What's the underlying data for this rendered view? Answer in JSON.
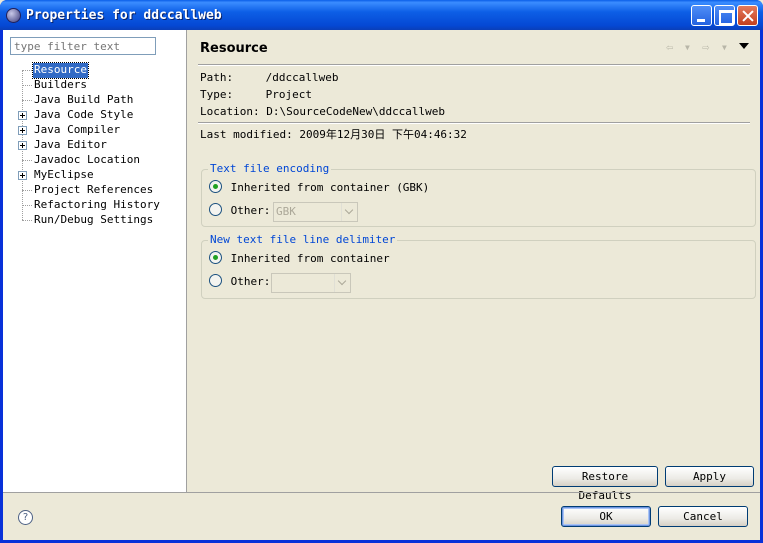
{
  "window": {
    "title": "Properties for ddccallweb"
  },
  "filter": {
    "placeholder": "type filter text"
  },
  "tree": {
    "items": [
      {
        "label": "Resource",
        "selected": true,
        "expandable": false
      },
      {
        "label": "Builders",
        "selected": false,
        "expandable": false
      },
      {
        "label": "Java Build Path",
        "selected": false,
        "expandable": false
      },
      {
        "label": "Java Code Style",
        "selected": false,
        "expandable": true
      },
      {
        "label": "Java Compiler",
        "selected": false,
        "expandable": true
      },
      {
        "label": "Java Editor",
        "selected": false,
        "expandable": true
      },
      {
        "label": "Javadoc Location",
        "selected": false,
        "expandable": false
      },
      {
        "label": "MyEclipse",
        "selected": false,
        "expandable": true
      },
      {
        "label": "Project References",
        "selected": false,
        "expandable": false
      },
      {
        "label": "Refactoring History",
        "selected": false,
        "expandable": false
      },
      {
        "label": "Run/Debug Settings",
        "selected": false,
        "expandable": false
      }
    ]
  },
  "page": {
    "title": "Resource",
    "path_label": "Path:",
    "path_value": "/ddccallweb",
    "type_label": "Type:",
    "type_value": "Project",
    "location_label": "Location:",
    "location_value": "D:\\SourceCodeNew\\ddccallweb",
    "modified_label": "Last modified:",
    "modified_value": "2009年12月30日 下午04:46:32"
  },
  "encoding": {
    "legend": "Text file encoding",
    "inherited_label": "Inherited from container (GBK)",
    "other_label": "Other:",
    "other_value": "GBK"
  },
  "delimiter": {
    "legend": "New text file line delimiter",
    "inherited_label": "Inherited from container",
    "other_label": "Other:",
    "other_value": ""
  },
  "buttons": {
    "restore_defaults": "Restore Defaults",
    "apply": "Apply",
    "ok": "OK",
    "cancel": "Cancel"
  },
  "icons": {
    "help": "?"
  }
}
